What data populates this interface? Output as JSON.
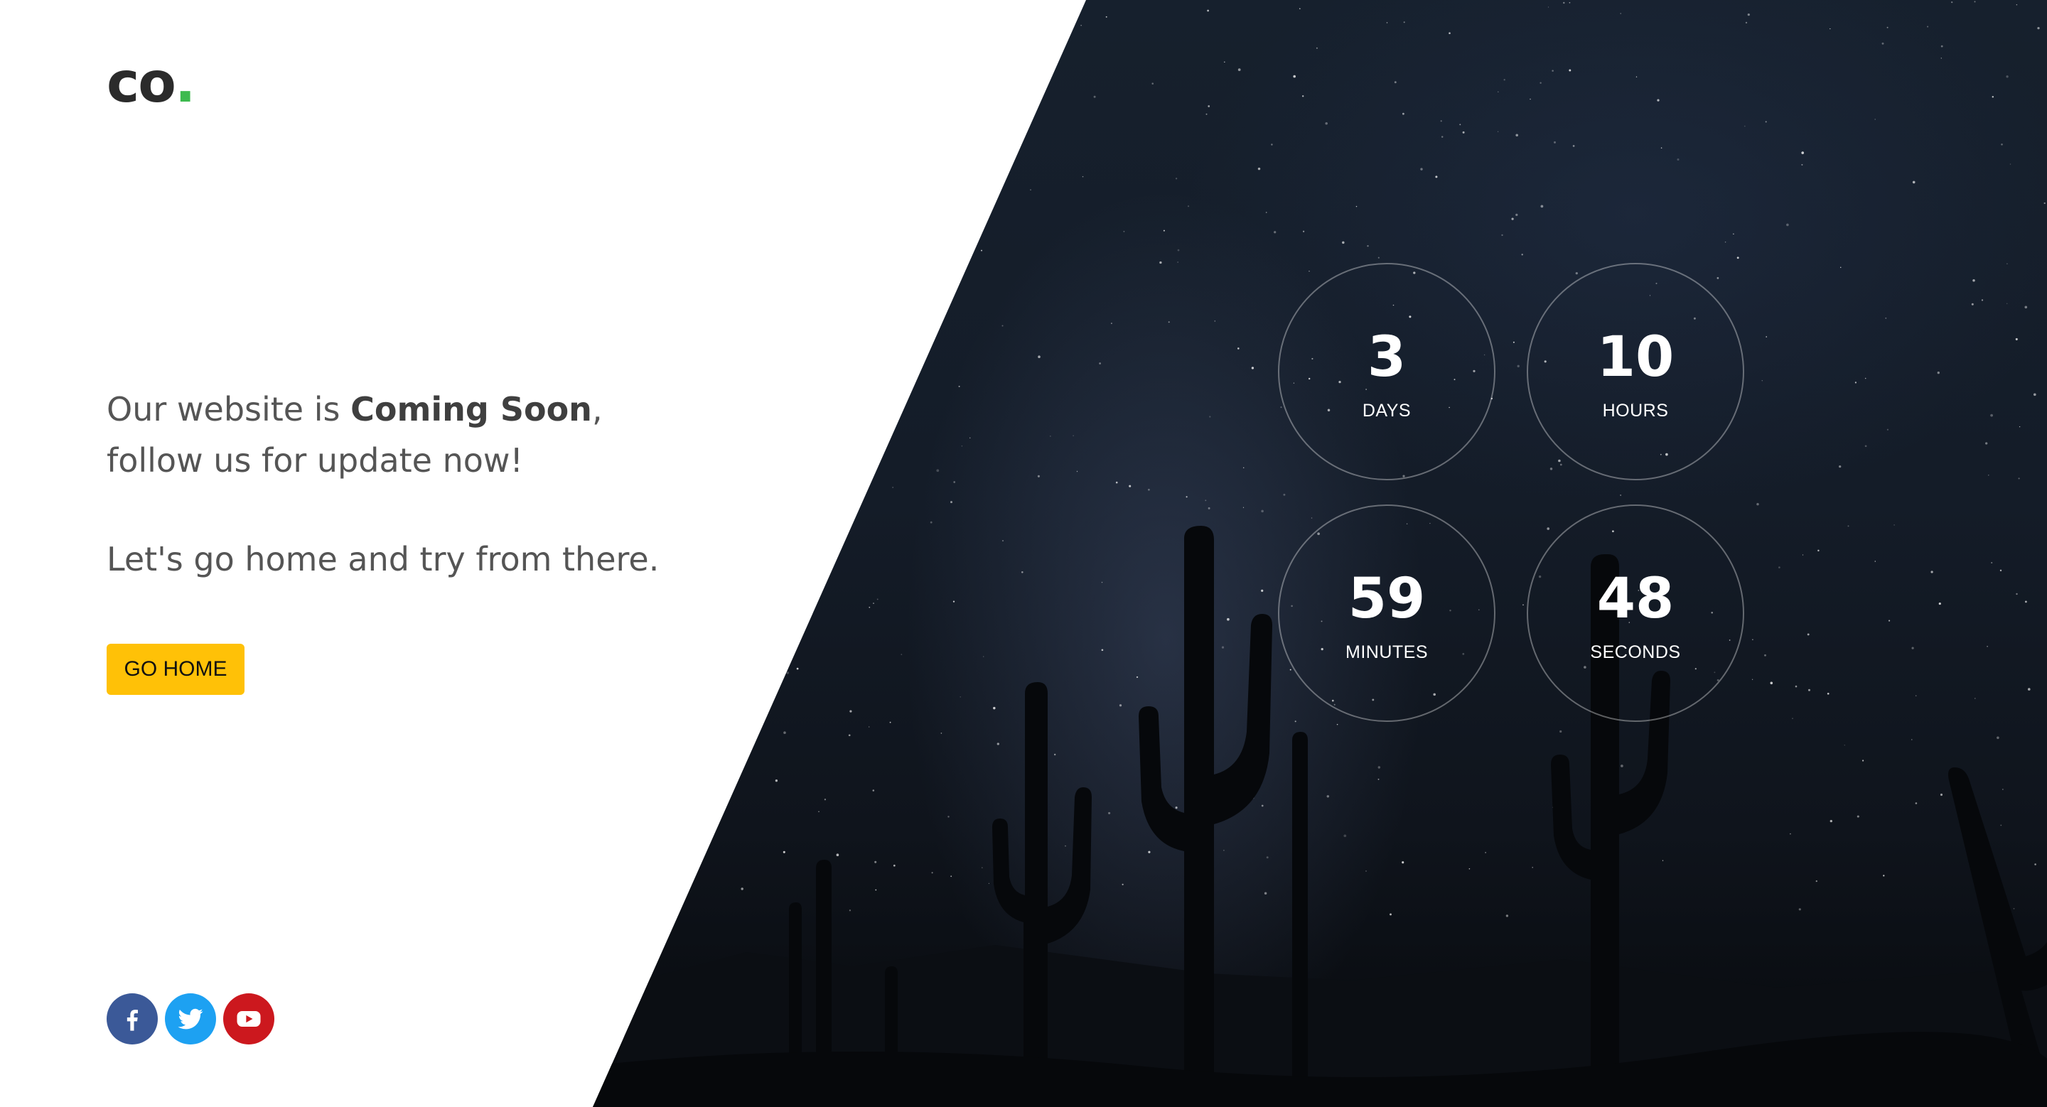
{
  "brand": {
    "logo_text": "co",
    "logo_dot": ".",
    "dot_color": "#3dba4e"
  },
  "hero": {
    "line1_prefix": "Our website is ",
    "line1_bold": "Coming Soon",
    "line1_suffix": ",",
    "line2": "follow us for update now!",
    "line3": "Let's go home and try from there.",
    "button_label": "GO HOME",
    "button_color": "#ffc107"
  },
  "countdown": [
    {
      "value": "3",
      "unit": "DAYS"
    },
    {
      "value": "10",
      "unit": "HOURS"
    },
    {
      "value": "59",
      "unit": "MINUTES"
    },
    {
      "value": "48",
      "unit": "SECONDS"
    }
  ],
  "social": [
    {
      "icon": "facebook-icon",
      "color": "#3b5998"
    },
    {
      "icon": "twitter-icon",
      "color": "#1da1f2"
    },
    {
      "icon": "youtube-icon",
      "color": "#cc181e"
    }
  ]
}
